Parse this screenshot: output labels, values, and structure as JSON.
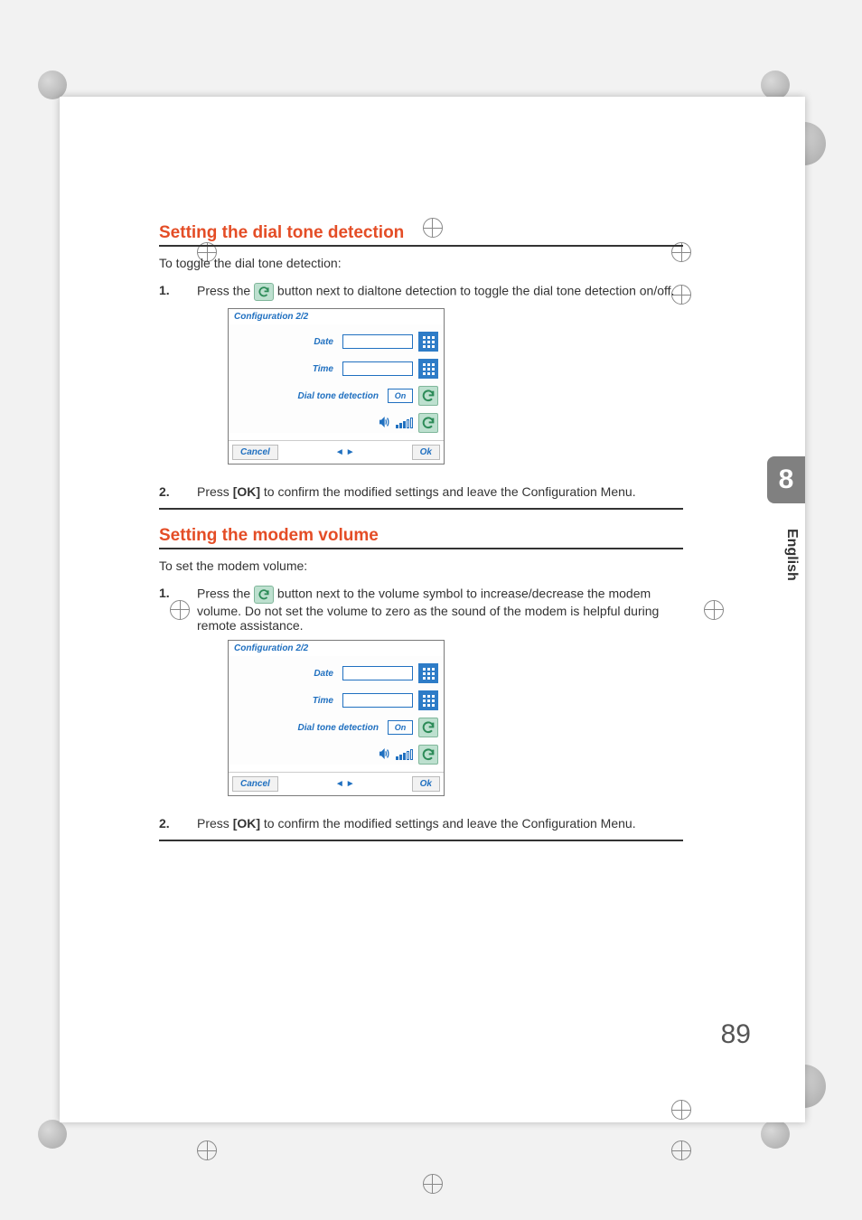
{
  "crop_marks": true,
  "section1": {
    "heading": "Setting the dial tone detection",
    "intro": "To toggle the dial tone detection:",
    "step1_num": "1.",
    "step1_pre": "Press the ",
    "step1_post": " button next to dialtone detection to toggle the dial tone detection on/off.",
    "step2_num": "2.",
    "step2_pre": "Press ",
    "step2_bold": "[OK]",
    "step2_post": " to confirm the modified settings and leave the Configuration Menu."
  },
  "section2": {
    "heading": "Setting the modem volume",
    "intro": "To set the modem volume:",
    "step1_num": "1.",
    "step1_pre": "Press the ",
    "step1_post": " button next to the volume symbol to increase/decrease the modem volume. Do not set the volume to zero as the sound of the modem is helpful during remote assistance.",
    "step2_num": "2.",
    "step2_pre": "Press ",
    "step2_bold": "[OK]",
    "step2_post": " to confirm the modified settings and leave the Configuration Menu."
  },
  "config_screen": {
    "title": "Configuration 2/2",
    "labels": {
      "date": "Date",
      "time": "Time",
      "dial_tone_detection": "Dial tone detection",
      "dial_tone_value": "On"
    },
    "footer": {
      "cancel": "Cancel",
      "ok": "Ok"
    }
  },
  "side": {
    "chapter": "8",
    "language": "English"
  },
  "page_number": "89"
}
